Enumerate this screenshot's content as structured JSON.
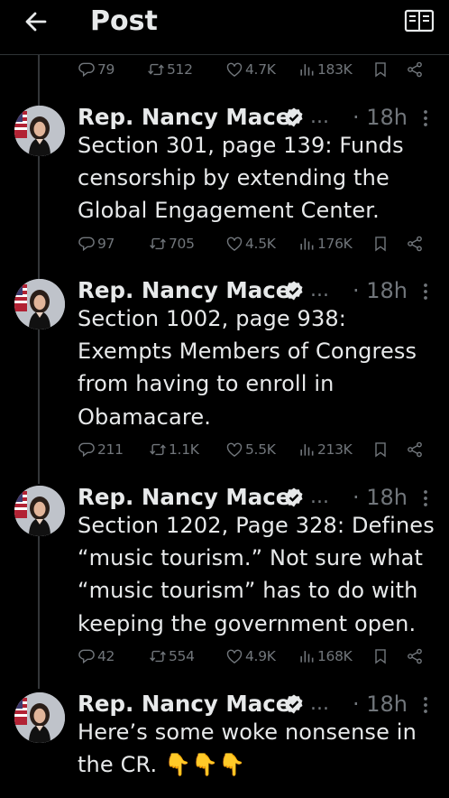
{
  "header": {
    "title": "Post"
  },
  "first_tweet_stats": {
    "replies": "79",
    "reposts": "512",
    "likes": "4.7K",
    "views": "183K"
  },
  "tweets": [
    {
      "author": "Rep. Nancy Mace",
      "ellipsis": "...",
      "time": "· 18h",
      "text": "Section 301, page 139: Funds censorship by extending the Global Engagement Center.",
      "stats": {
        "replies": "97",
        "reposts": "705",
        "likes": "4.5K",
        "views": "176K"
      }
    },
    {
      "author": "Rep. Nancy Mace",
      "ellipsis": "...",
      "time": "· 18h",
      "text": "Section 1002, page 938: Exempts Members of Congress from having to enroll in Obamacare.",
      "stats": {
        "replies": "211",
        "reposts": "1.1K",
        "likes": "5.5K",
        "views": "213K"
      }
    },
    {
      "author": "Rep. Nancy Mace",
      "ellipsis": "...",
      "time": "· 18h",
      "text": "Section 1202, Page 328: Defines “music tourism.” Not sure what “music tourism” has to do with keeping the government open.",
      "stats": {
        "replies": "42",
        "reposts": "554",
        "likes": "4.9K",
        "views": "168K"
      }
    },
    {
      "author": "Rep. Nancy Mace",
      "ellipsis": "...",
      "time": "· 18h",
      "text": "Here’s some woke nonsense in the CR. 👇👇👇"
    }
  ],
  "colors": {
    "background": "#000000",
    "text": "#e7e9ea",
    "muted": "#71767b",
    "verified": "#1d9bf0",
    "divider": "#2f3336"
  },
  "icons": [
    "back-arrow-icon",
    "reader-mode-icon",
    "reply-icon",
    "repost-icon",
    "like-icon",
    "views-icon",
    "bookmark-icon",
    "share-icon",
    "verified-badge-icon",
    "more-icon"
  ]
}
